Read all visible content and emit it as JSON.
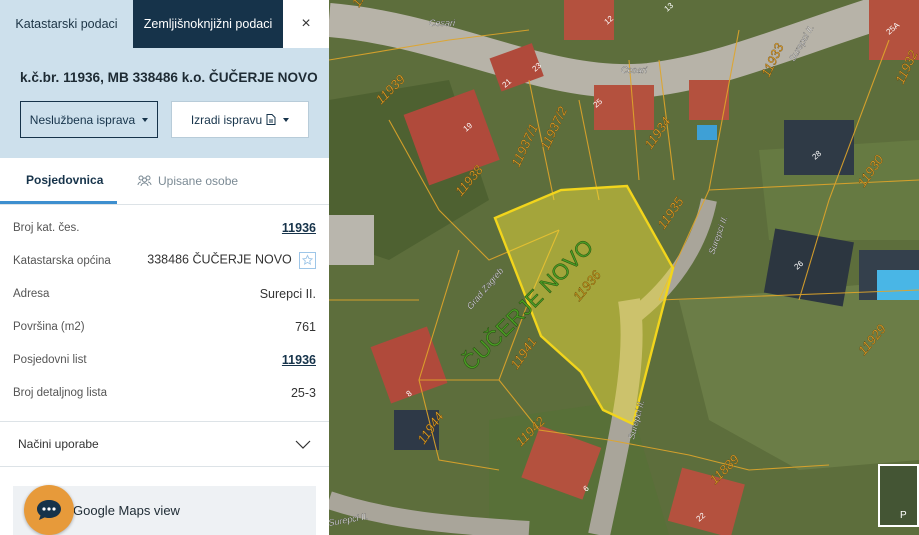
{
  "tabs": {
    "katastarski": "Katastarski podaci",
    "zemljisnoknjizni": "Zemljišnoknjižni podaci",
    "close": "×"
  },
  "parcel_title": "k.č.br. 11936, MB 338486 k.o. ČUČERJE NOVO",
  "buttons": {
    "neluzbena": "Neslužbena isprava",
    "izradi": "Izradi ispravu"
  },
  "subtabs": {
    "posjedovnica": "Posjedovnica",
    "upisane": "Upisane osobe"
  },
  "properties": [
    {
      "label": "Broj kat. čes.",
      "value": "11936",
      "link": true
    },
    {
      "label": "Katastarska općina",
      "value": "338486 ČUČERJE NOVO",
      "star": true
    },
    {
      "label": "Adresa",
      "value": "Surepci II."
    },
    {
      "label": "Površina (m2)",
      "value": "761"
    },
    {
      "label": "Posjedovni list",
      "value": "11936",
      "link": true
    },
    {
      "label": "Broj detaljnog lista",
      "value": "25-3"
    }
  ],
  "accordion": {
    "label": "Načini uporabe"
  },
  "gmaps": {
    "label": "Google Maps view"
  },
  "map": {
    "highlight_label": "ČUČERJE NOVO",
    "parcel_numbers": [
      "11939",
      "11938",
      "11937/1",
      "11937/2",
      "11934",
      "11935",
      "11933",
      "11930",
      "11929",
      "11936",
      "11941",
      "11942",
      "11944",
      "11889",
      "11937",
      "11932"
    ],
    "street_labels": [
      "Cesari",
      "Surepci II.",
      "Grad Zagreb"
    ],
    "house_numbers": [
      "12",
      "13",
      "21",
      "23",
      "25",
      "19",
      "28",
      "26",
      "25A",
      "6",
      "8",
      "22"
    ],
    "corner_label": "P"
  },
  "colors": {
    "navy": "#16334a",
    "light_blue": "#cde0ec",
    "accent_blue": "#3d8fcf",
    "parcel_yellow": "#f2e23a",
    "parcel_line": "#e0a52a",
    "chat_orange": "#e79a3a"
  },
  "icons": [
    "close-icon",
    "caret-down-icon",
    "document-icon",
    "parcel-icon",
    "people-icon",
    "star-icon",
    "chevron-down-icon",
    "chat-icon"
  ]
}
